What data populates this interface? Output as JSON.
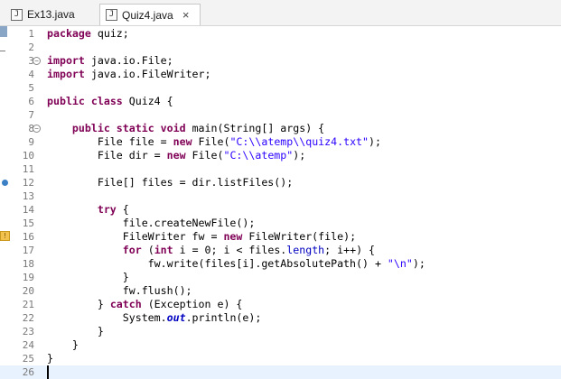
{
  "tabs": [
    {
      "label": "Ex13.java",
      "icon": "java-file-icon",
      "active": false
    },
    {
      "label": "Quiz4.java",
      "icon": "java-file-icon",
      "active": true,
      "close": "×"
    }
  ],
  "editor": {
    "lines": [
      {
        "num": "1",
        "text": "package quiz;"
      },
      {
        "num": "2",
        "text": ""
      },
      {
        "num": "3",
        "text": "import java.io.File;",
        "fold": "−"
      },
      {
        "num": "4",
        "text": "import java.io.FileWriter;"
      },
      {
        "num": "5",
        "text": ""
      },
      {
        "num": "6",
        "text": "public class Quiz4 {"
      },
      {
        "num": "7",
        "text": ""
      },
      {
        "num": "8",
        "text": "    public static void main(String[] args) {",
        "fold": "−"
      },
      {
        "num": "9",
        "text": "        File file = new File(\"C:\\\\atemp\\\\quiz4.txt\");"
      },
      {
        "num": "10",
        "text": "        File dir = new File(\"C:\\\\atemp\");"
      },
      {
        "num": "11",
        "text": ""
      },
      {
        "num": "12",
        "text": "        File[] files = dir.listFiles();",
        "marker": "breakpoint"
      },
      {
        "num": "13",
        "text": ""
      },
      {
        "num": "14",
        "text": "        try {"
      },
      {
        "num": "15",
        "text": "            file.createNewFile();"
      },
      {
        "num": "16",
        "text": "            FileWriter fw = new FileWriter(file);",
        "marker": "warning"
      },
      {
        "num": "17",
        "text": "            for (int i = 0; i < files.length; i++) {"
      },
      {
        "num": "18",
        "text": "                fw.write(files[i].getAbsolutePath() + \"\\n\");"
      },
      {
        "num": "19",
        "text": "            }"
      },
      {
        "num": "20",
        "text": "            fw.flush();"
      },
      {
        "num": "21",
        "text": "        } catch (Exception e) {"
      },
      {
        "num": "22",
        "text": "            System.out.println(e);"
      },
      {
        "num": "23",
        "text": "        }"
      },
      {
        "num": "24",
        "text": "    }"
      },
      {
        "num": "25",
        "text": "}"
      },
      {
        "num": "26",
        "text": "",
        "current": true
      }
    ]
  },
  "colors": {
    "keyword": "#7f0055",
    "string": "#2a00ff",
    "field": "#0000c0",
    "line_number": "#787878",
    "current_line": "#e8f2fe"
  }
}
